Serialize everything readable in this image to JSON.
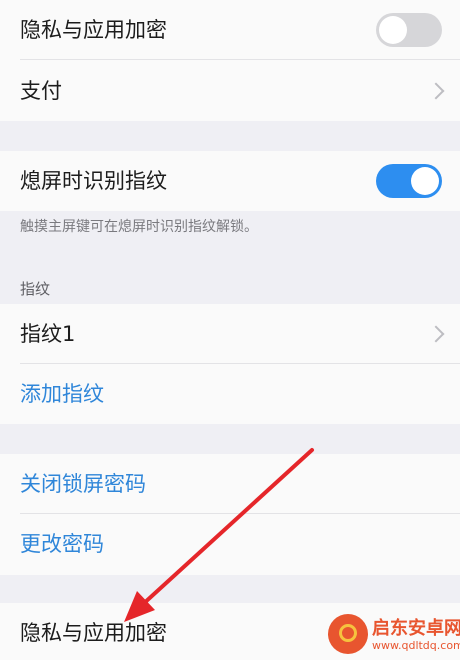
{
  "settings": {
    "privacy_top_label": "隐私与应用加密",
    "payment_label": "支付",
    "screen_off_fingerprint_label": "熄屏时识别指纹",
    "screen_off_fingerprint_note": "触摸主屏键可在熄屏时识别指纹解锁。",
    "fingerprint_section_label": "指纹",
    "fingerprint1_label": "指纹1",
    "add_fingerprint_label": "添加指纹",
    "close_lock_password_label": "关闭锁屏密码",
    "change_password_label": "更改密码",
    "privacy_bottom_label": "隐私与应用加密"
  },
  "toggles": {
    "privacy_top": "off",
    "screen_off_fingerprint": "on"
  },
  "colors": {
    "accent_blue": "#2f86d9",
    "toggle_on": "#2d8ef0",
    "annotation_arrow": "#e5262a"
  },
  "watermark": {
    "title": "启东安卓网",
    "url": "www.qdltdq.com"
  }
}
